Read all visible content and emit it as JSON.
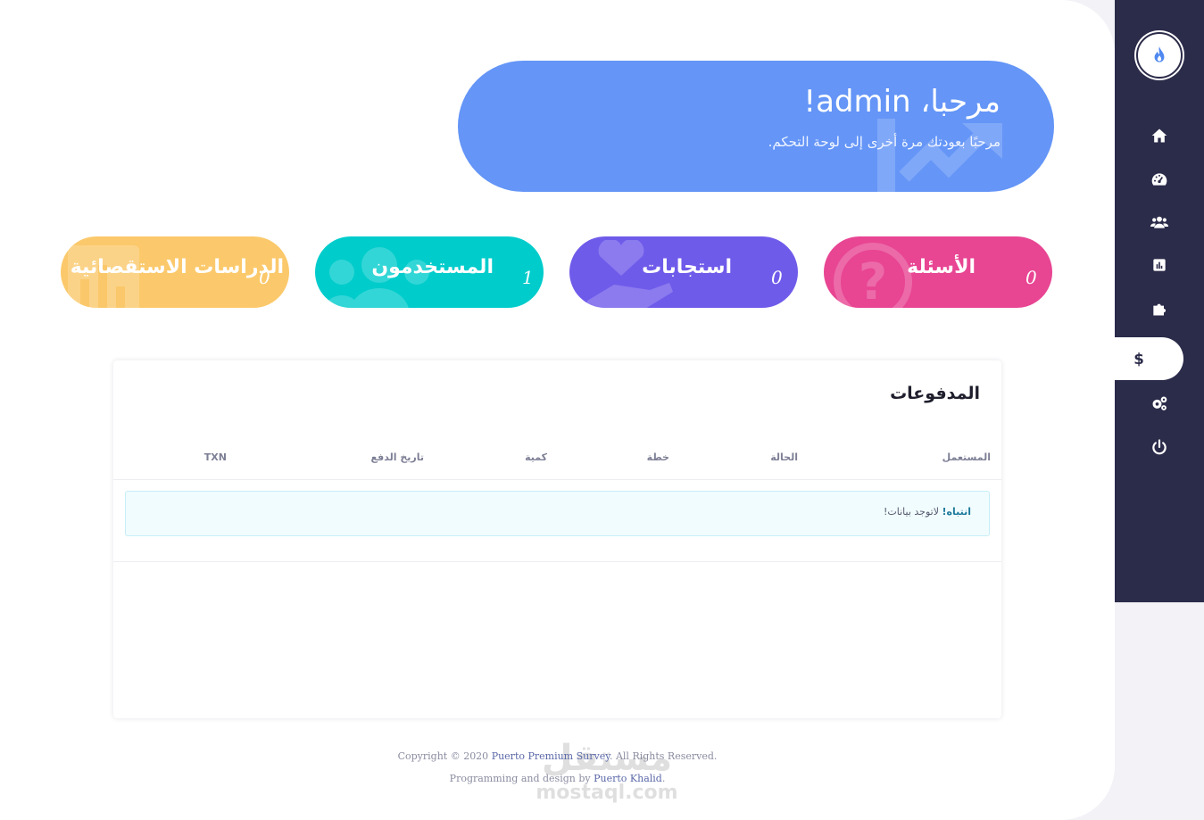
{
  "colors": {
    "sidebar": "#2b2b4a",
    "welcome": "#6495f7",
    "questions": "#e84593",
    "responses": "#6f5bea",
    "users": "#00cccc",
    "surveys": "#fbc96b"
  },
  "sidebar": {
    "items": [
      {
        "icon": "home-icon"
      },
      {
        "icon": "dashboard-gauge-icon"
      },
      {
        "icon": "users-icon"
      },
      {
        "icon": "chart-icon"
      },
      {
        "icon": "puzzle-icon"
      },
      {
        "icon": "dollar-icon",
        "active": true
      },
      {
        "icon": "gears-icon"
      },
      {
        "icon": "power-icon"
      }
    ]
  },
  "welcome": {
    "title": "مرحبا، admin!",
    "subtitle": "مرحبًا بعودتك مرة أخرى إلى لوحة التحكم."
  },
  "stats": [
    {
      "label": "الأسئلة",
      "count": "0",
      "icon": "question-icon"
    },
    {
      "label": "استجابات",
      "count": "0",
      "icon": "hand-heart-icon"
    },
    {
      "label": "المستخدمون",
      "count": "1",
      "icon": "users-icon"
    },
    {
      "label": "الدراسات الاستقصائية",
      "count": "0",
      "icon": "bar-chart-icon"
    }
  ],
  "payments": {
    "title": "المدفوعات",
    "columns": [
      "المستعمل",
      "الحالة",
      "خطة",
      "كمية",
      "تاريخ الدفع",
      "TXN"
    ],
    "alert_strong": "انتباه!",
    "alert_text": " لاتوجد بيانات!"
  },
  "footer": {
    "line1_prefix": "Copyright © 2020 ",
    "line1_link": "Puerto Premium Survey",
    "line1_suffix": ". All Rights Reserved.",
    "line2_prefix": "Programming and design by ",
    "line2_link": "Puerto Khalid",
    "line2_suffix": "."
  },
  "watermark": {
    "arabic": "مستقل",
    "latin": "mostaql.com"
  }
}
